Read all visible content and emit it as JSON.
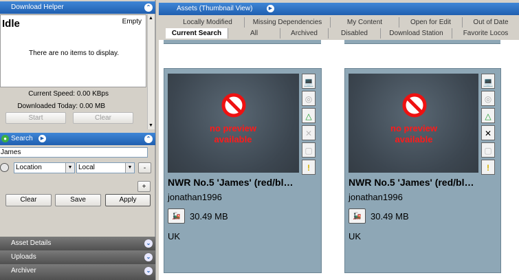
{
  "download_helper": {
    "header": "Download Helper",
    "status": "Idle",
    "queue_state": "Empty",
    "empty_message": "There are no items to display.",
    "current_speed": "Current Speed: 0.00 KBps",
    "downloaded_today": "Downloaded Today: 0.00 MB",
    "start_label": "Start",
    "clear_label": "Clear"
  },
  "search": {
    "header": "Search",
    "query": "James",
    "filter_field": "Location",
    "filter_value": "Local",
    "minus_label": "-",
    "plus_label": "+",
    "clear_label": "Clear",
    "save_label": "Save",
    "apply_label": "Apply"
  },
  "collapsed_panes": [
    "Asset Details",
    "Uploads",
    "Archiver"
  ],
  "assets": {
    "header": "Assets (Thumbnail View)",
    "tabs_row1": [
      "Locally Modified",
      "Missing Dependencies",
      "My Content",
      "Open for Edit",
      "Out of Date"
    ],
    "tabs_row2": [
      "Current Search",
      "All",
      "Archived",
      "Disabled",
      "Download Station",
      "Favorite Locos"
    ],
    "active_tab": "Current Search",
    "cards": [
      {
        "title": "NWR No.5 'James' (red/bl…",
        "author": "jonathan1996",
        "size": "30.49 MB",
        "location": "UK",
        "preview_text": "no preview available"
      },
      {
        "title": "NWR No.5 'James' (red/bl…",
        "author": "jonathan1996",
        "size": "30.49 MB",
        "location": "UK",
        "preview_text": "no preview available"
      }
    ]
  },
  "colors": {
    "header_blue": "#2a6cc4",
    "card_bg": "#8ea7b6",
    "no_preview_red": "#ff1a1a"
  }
}
